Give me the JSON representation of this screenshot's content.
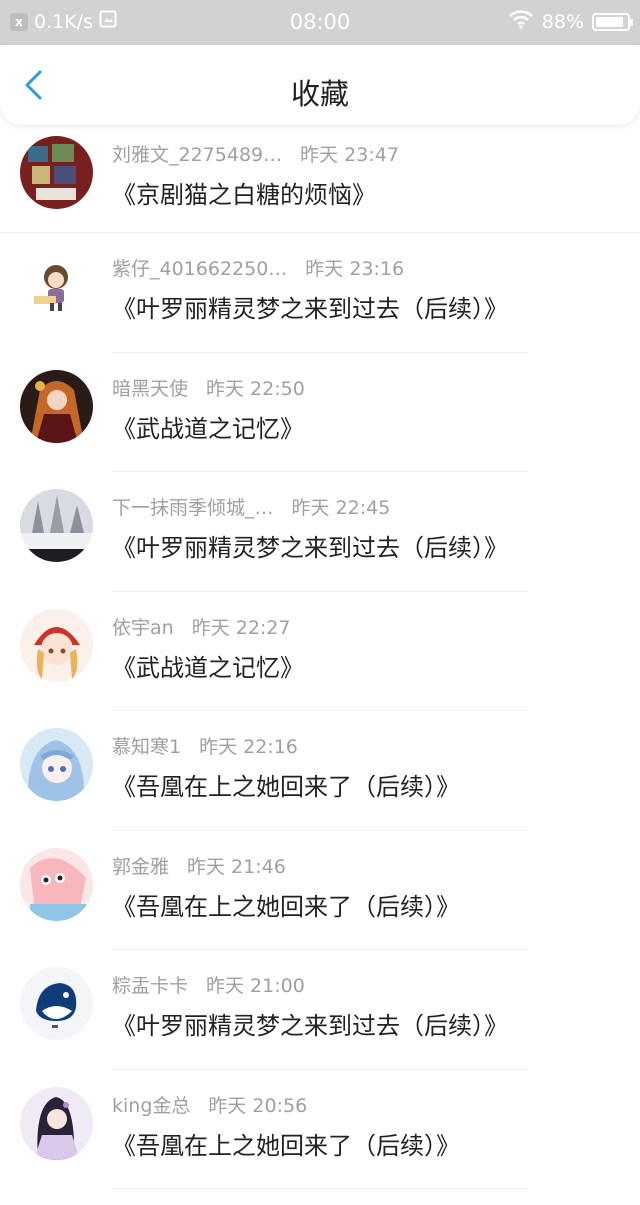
{
  "status_bar": {
    "speed": "0.1K/s",
    "time": "08:00",
    "battery": "88%",
    "battery_level": 0.88
  },
  "nav": {
    "title": "收藏"
  },
  "items": [
    {
      "user": "刘雅文_2275489…",
      "time": "昨天 23:47",
      "title": "《京剧猫之白糖的烦恼》",
      "avatar_bg": "#7a1f1f"
    },
    {
      "user": "紫仔_401662250…",
      "time": "昨天 23:16",
      "title": "《叶罗丽精灵梦之来到过去（后续）》",
      "avatar_bg": "#f4ede6"
    },
    {
      "user": "暗黑天使",
      "time": "昨天 22:50",
      "title": "《武战道之记忆》",
      "avatar_bg": "#4a2a22"
    },
    {
      "user": "下一抹雨季倾城_…",
      "time": "昨天 22:45",
      "title": "《叶罗丽精灵梦之来到过去（后续）》",
      "avatar_bg": "#c9cbd4"
    },
    {
      "user": "依宇an",
      "time": "昨天 22:27",
      "title": "《武战道之记忆》",
      "avatar_bg": "#f2d7c8"
    },
    {
      "user": "慕知寒1",
      "time": "昨天 22:16",
      "title": "《吾凰在上之她回来了（后续）》",
      "avatar_bg": "#b9d3ea"
    },
    {
      "user": "郭金雅",
      "time": "昨天 21:46",
      "title": "《吾凰在上之她回来了（后续）》",
      "avatar_bg": "#f5c9cc"
    },
    {
      "user": "粽盂卡卡",
      "time": "昨天 21:00",
      "title": "《叶罗丽精灵梦之来到过去（后续）》",
      "avatar_bg": "#f4f6f8"
    },
    {
      "user": "king金总",
      "time": "昨天 20:56",
      "title": "《吾凰在上之她回来了（后续）》",
      "avatar_bg": "#e3dcec"
    }
  ]
}
